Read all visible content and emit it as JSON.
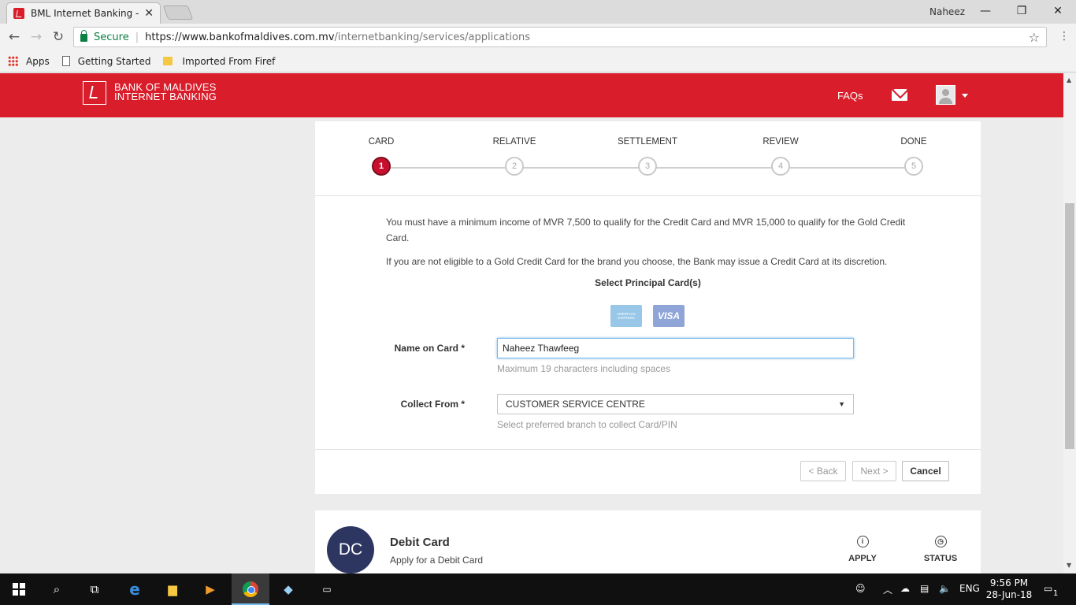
{
  "browser": {
    "tab_title": "BML Internet Banking - B",
    "profile_name": "Naheez",
    "secure_label": "Secure",
    "url_host": "https://www.bankofmaldives.com.mv",
    "url_path": "/internetbanking/services/applications",
    "bookmarks": [
      "Apps",
      "Getting Started",
      "Imported From Firef"
    ]
  },
  "header": {
    "brand_line1": "BANK OF MALDIVES",
    "brand_line2": "INTERNET BANKING",
    "faqs": "FAQs"
  },
  "steps": [
    {
      "label": "CARD",
      "num": "1"
    },
    {
      "label": "RELATIVE",
      "num": "2"
    },
    {
      "label": "SETTLEMENT",
      "num": "3"
    },
    {
      "label": "REVIEW",
      "num": "4"
    },
    {
      "label": "DONE",
      "num": "5"
    }
  ],
  "form": {
    "info1": "You must have a minimum income of MVR 7,500 to qualify for the Credit Card and MVR 15,000 to qualify for the Gold Credit Card.",
    "info2": "If you are not eligible to a Gold Credit Card for the brand you choose, the Bank may issue a Credit Card at its discretion.",
    "select_title": "Select Principal Card(s)",
    "amex_text": "AMERICAN EXPRESS",
    "visa_text": "VISA",
    "name_label": "Name on Card *",
    "name_value": "Naheez Thawfeeg",
    "name_help": "Maximum 19 characters including spaces",
    "collect_label": "Collect From *",
    "collect_value": "CUSTOMER SERVICE CENTRE",
    "collect_help": "Select preferred branch to collect Card/PIN",
    "back": "< Back",
    "next": "Next >",
    "cancel": "Cancel"
  },
  "debit": {
    "initials": "DC",
    "title": "Debit Card",
    "subtitle": "Apply for a Debit Card",
    "apply": "APPLY",
    "status": "STATUS"
  },
  "taskbar": {
    "lang": "ENG",
    "time": "9:56 PM",
    "date": "28-Jun-18",
    "notif_count": "1"
  }
}
